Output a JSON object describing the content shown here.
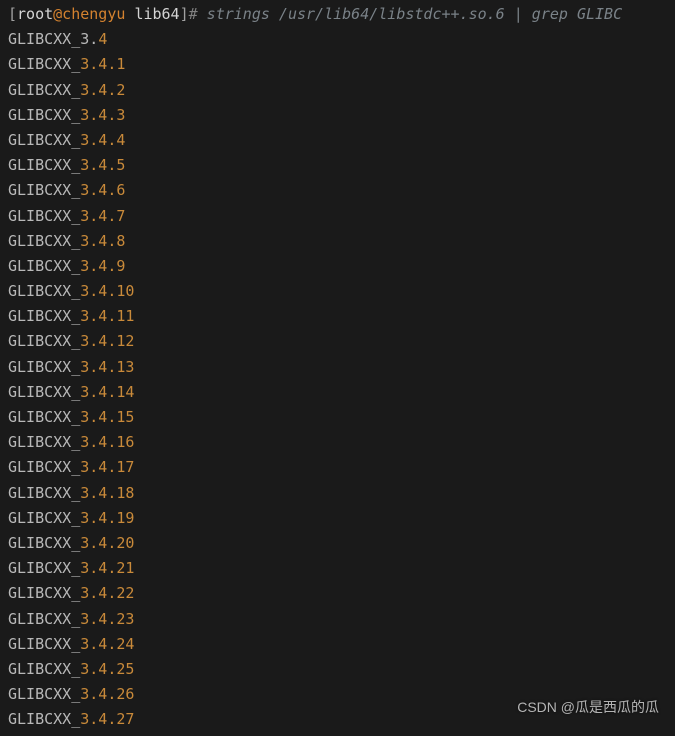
{
  "prompt": {
    "bracket_open": "[",
    "user": "root",
    "at_host": "@chengyu",
    "space": " ",
    "dir": "lib64",
    "bracket_close": "]",
    "hash": "#",
    "command": " strings /usr/lib64/libstdc++.so.6 | grep GLIBC"
  },
  "first_line": {
    "prefix": "GLIBCXX_3.",
    "version": "4"
  },
  "lines": [
    {
      "prefix": "GLIBCXX_",
      "version": "3.4.1"
    },
    {
      "prefix": "GLIBCXX_",
      "version": "3.4.2"
    },
    {
      "prefix": "GLIBCXX_",
      "version": "3.4.3"
    },
    {
      "prefix": "GLIBCXX_",
      "version": "3.4.4"
    },
    {
      "prefix": "GLIBCXX_",
      "version": "3.4.5"
    },
    {
      "prefix": "GLIBCXX_",
      "version": "3.4.6"
    },
    {
      "prefix": "GLIBCXX_",
      "version": "3.4.7"
    },
    {
      "prefix": "GLIBCXX_",
      "version": "3.4.8"
    },
    {
      "prefix": "GLIBCXX_",
      "version": "3.4.9"
    },
    {
      "prefix": "GLIBCXX_",
      "version": "3.4.10"
    },
    {
      "prefix": "GLIBCXX_",
      "version": "3.4.11"
    },
    {
      "prefix": "GLIBCXX_",
      "version": "3.4.12"
    },
    {
      "prefix": "GLIBCXX_",
      "version": "3.4.13"
    },
    {
      "prefix": "GLIBCXX_",
      "version": "3.4.14"
    },
    {
      "prefix": "GLIBCXX_",
      "version": "3.4.15"
    },
    {
      "prefix": "GLIBCXX_",
      "version": "3.4.16"
    },
    {
      "prefix": "GLIBCXX_",
      "version": "3.4.17"
    },
    {
      "prefix": "GLIBCXX_",
      "version": "3.4.18"
    },
    {
      "prefix": "GLIBCXX_",
      "version": "3.4.19"
    },
    {
      "prefix": "GLIBCXX_",
      "version": "3.4.20"
    },
    {
      "prefix": "GLIBCXX_",
      "version": "3.4.21"
    },
    {
      "prefix": "GLIBCXX_",
      "version": "3.4.22"
    },
    {
      "prefix": "GLIBCXX_",
      "version": "3.4.23"
    },
    {
      "prefix": "GLIBCXX_",
      "version": "3.4.24"
    },
    {
      "prefix": "GLIBCXX_",
      "version": "3.4.25"
    },
    {
      "prefix": "GLIBCXX_",
      "version": "3.4.26"
    },
    {
      "prefix": "GLIBCXX_",
      "version": "3.4.27"
    }
  ],
  "watermark": "CSDN @瓜是西瓜的瓜"
}
